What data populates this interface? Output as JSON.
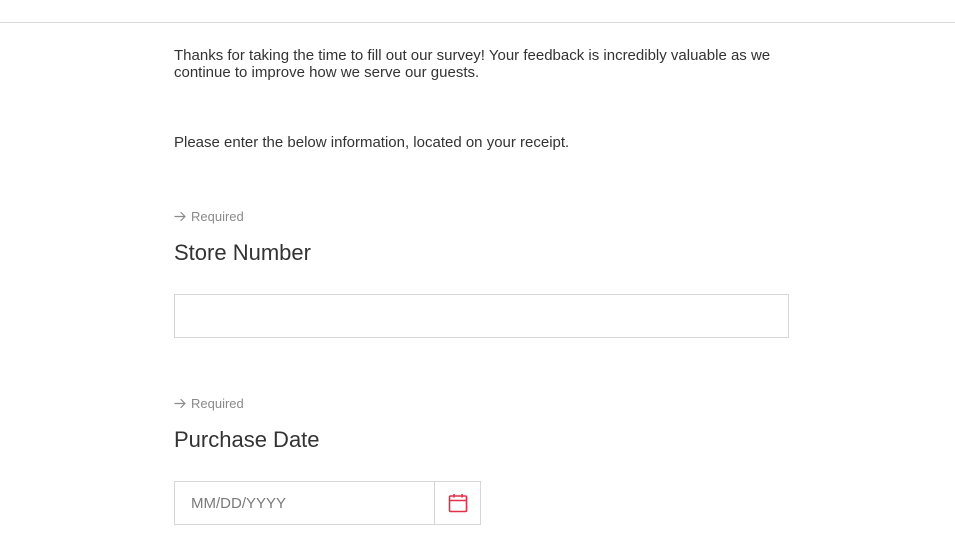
{
  "survey": {
    "intro": "Thanks for taking the time to fill out our survey! Your feedback is incredibly valuable as we continue to improve how we serve our guests.",
    "instruction": "Please enter the below information, located on your receipt."
  },
  "questions": [
    {
      "required_label": "Required",
      "title": "Store Number",
      "value": ""
    },
    {
      "required_label": "Required",
      "title": "Purchase Date",
      "placeholder": "MM/DD/YYYY",
      "icon": "calendar-icon"
    }
  ],
  "colors": {
    "accent": "#e0314b",
    "required_text": "#8a8a8a",
    "border": "#d6d6d6"
  }
}
